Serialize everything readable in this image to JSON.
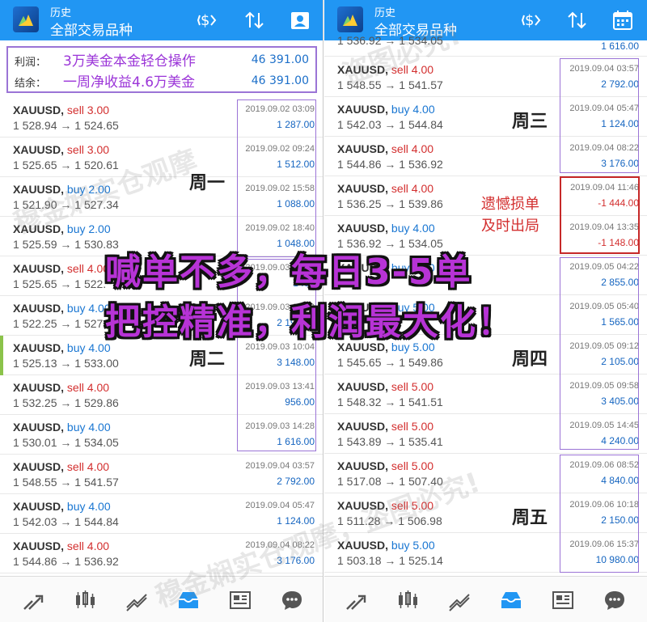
{
  "header": {
    "subtitle": "历史",
    "title": "全部交易品种"
  },
  "summary": {
    "profit_label": "利润：",
    "profit_value": "46 391.00",
    "balance_label": "结余：",
    "balance_value": "46 391.00",
    "note1": "3万美金本金轻仓操作",
    "note2": "一周净收益4.6万美金"
  },
  "left_rows": [
    {
      "symbol": "XAUUSD,",
      "side": "sell",
      "side_label": "sell 3.00",
      "price": "1 528.94 → 1 524.65",
      "date": "2019.09.02 03:09",
      "profit": "1 287.00"
    },
    {
      "symbol": "XAUUSD,",
      "side": "sell",
      "side_label": "sell 3.00",
      "price": "1 525.65 → 1 520.61",
      "date": "2019.09.02 09:24",
      "profit": "1 512.00"
    },
    {
      "symbol": "XAUUSD,",
      "side": "buy",
      "side_label": "buy 2.00",
      "price": "1 521.90 → 1 527.34",
      "date": "2019.09.02 15:58",
      "profit": "1 088.00"
    },
    {
      "symbol": "XAUUSD,",
      "side": "buy",
      "side_label": "buy 2.00",
      "price": "1 525.59 → 1 530.83",
      "date": "2019.09.02 18:40",
      "profit": "1 048.00"
    },
    {
      "symbol": "XAUUSD,",
      "side": "sell",
      "side_label": "sell 4.00",
      "price": "1 525.65 → 1 522.",
      "date": "2019.09.03 05:02",
      "profit": "1 .00"
    },
    {
      "symbol": "XAUUSD,",
      "side": "buy",
      "side_label": "buy 4.00",
      "price": "1 522.25 → 1 527",
      "date": "2019.09.03 08:03",
      "profit": "2 196.00"
    },
    {
      "symbol": "XAUUSD,",
      "side": "buy",
      "side_label": "buy 4.00",
      "price": "1 525.13 → 1 533.00",
      "date": "2019.09.03 10:04",
      "profit": "3 148.00"
    },
    {
      "symbol": "XAUUSD,",
      "side": "sell",
      "side_label": "sell 4.00",
      "price": "1 532.25 → 1 529.86",
      "date": "2019.09.03 13:41",
      "profit": "956.00"
    },
    {
      "symbol": "XAUUSD,",
      "side": "buy",
      "side_label": "buy 4.00",
      "price": "1 530.01 → 1 534.05",
      "date": "2019.09.03 14:28",
      "profit": "1 616.00"
    },
    {
      "symbol": "XAUUSD,",
      "side": "sell",
      "side_label": "sell 4.00",
      "price": "1 548.55 → 1 541.57",
      "date": "2019.09.04 03:57",
      "profit": "2 792.00"
    },
    {
      "symbol": "XAUUSD,",
      "side": "buy",
      "side_label": "buy 4.00",
      "price": "1 542.03 → 1 544.84",
      "date": "2019.09.04 05:47",
      "profit": "1 124.00"
    },
    {
      "symbol": "XAUUSD,",
      "side": "sell",
      "side_label": "sell 4.00",
      "price": "1 544.86 → 1 536.92",
      "date": "2019.09.04 08:22",
      "profit": "3 176.00"
    }
  ],
  "right_top_partial": {
    "price": "1 536.92 → 1 534.05",
    "profit": "1 616.00"
  },
  "right_rows": [
    {
      "symbol": "XAUUSD,",
      "side": "sell",
      "side_label": "sell 4.00",
      "price": "1 548.55 → 1 541.57",
      "date": "2019.09.04 03:57",
      "profit": "2 792.00",
      "neg": false
    },
    {
      "symbol": "XAUUSD,",
      "side": "buy",
      "side_label": "buy 4.00",
      "price": "1 542.03 → 1 544.84",
      "date": "2019.09.04 05:47",
      "profit": "1 124.00",
      "neg": false
    },
    {
      "symbol": "XAUUSD,",
      "side": "sell",
      "side_label": "sell 4.00",
      "price": "1 544.86 → 1 536.92",
      "date": "2019.09.04 08:22",
      "profit": "3 176.00",
      "neg": false
    },
    {
      "symbol": "XAUUSD,",
      "side": "sell",
      "side_label": "sell 4.00",
      "price": "1 536.25 → 1 539.86",
      "date": "2019.09.04 11:46",
      "profit": "-1 444.00",
      "neg": true
    },
    {
      "symbol": "XAUUSD,",
      "side": "buy",
      "side_label": "buy 4.00",
      "price": "1 536.92 → 1 534.05",
      "date": "2019.09.04 13:35",
      "profit": "-1 148.00",
      "neg": true
    },
    {
      "symbol": "XAUUSD,",
      "side": "buy",
      "side_label": "buy 5.00",
      "price": "",
      "date": "2019.09.05 04:22",
      "profit": "2 855.00",
      "neg": false
    },
    {
      "symbol": "XAUUSD,",
      "side": "buy",
      "side_label": "buy 5.00",
      "price": "",
      "date": "2019.09.05 05:40",
      "profit": "1 565.00",
      "neg": false
    },
    {
      "symbol": "XAUUSD,",
      "side": "buy",
      "side_label": "buy 5.00",
      "price": "1 545.65 → 1 549.86",
      "date": "2019.09.05 09:12",
      "profit": "2 105.00",
      "neg": false
    },
    {
      "symbol": "XAUUSD,",
      "side": "sell",
      "side_label": "sell 5.00",
      "price": "1 548.32 → 1 541.51",
      "date": "2019.09.05 09:58",
      "profit": "3 405.00",
      "neg": false
    },
    {
      "symbol": "XAUUSD,",
      "side": "sell",
      "side_label": "sell 5.00",
      "price": "1 543.89 → 1 535.41",
      "date": "2019.09.05 14:45",
      "profit": "4 240.00",
      "neg": false
    },
    {
      "symbol": "XAUUSD,",
      "side": "sell",
      "side_label": "sell 5.00",
      "price": "1 517.08 → 1 507.40",
      "date": "2019.09.06 08:52",
      "profit": "4 840.00",
      "neg": false
    },
    {
      "symbol": "XAUUSD,",
      "side": "sell",
      "side_label": "sell 5.00",
      "price": "1 511.28 → 1 506.98",
      "date": "2019.09.06 10:18",
      "profit": "2 150.00",
      "neg": false
    },
    {
      "symbol": "XAUUSD,",
      "side": "buy",
      "side_label": "buy 5.00",
      "price": "1 503.18 → 1 525.14",
      "date": "2019.09.06 15:37",
      "profit": "10 980.00",
      "neg": false
    }
  ],
  "annotations": {
    "mon": "周一",
    "tue": "周二",
    "wed": "周三",
    "thu": "周四",
    "fri": "周五",
    "loss_note_1": "遗憾损单",
    "loss_note_2": "及时出局",
    "slogan_1": "喊单不多，每日3-5单",
    "slogan_2": "把控精准，利润最大化！"
  },
  "watermarks": [
    "穆金娴实仓观摩",
    "盗图必究!",
    "穆金娴实仓观摩，盗图必究!"
  ],
  "colors": {
    "header": "#2196f3",
    "sell": "#d32f2f",
    "buy": "#1976d2",
    "profit": "#1565c0",
    "frame": "#9b74d6",
    "slogan": "#b733d6"
  }
}
